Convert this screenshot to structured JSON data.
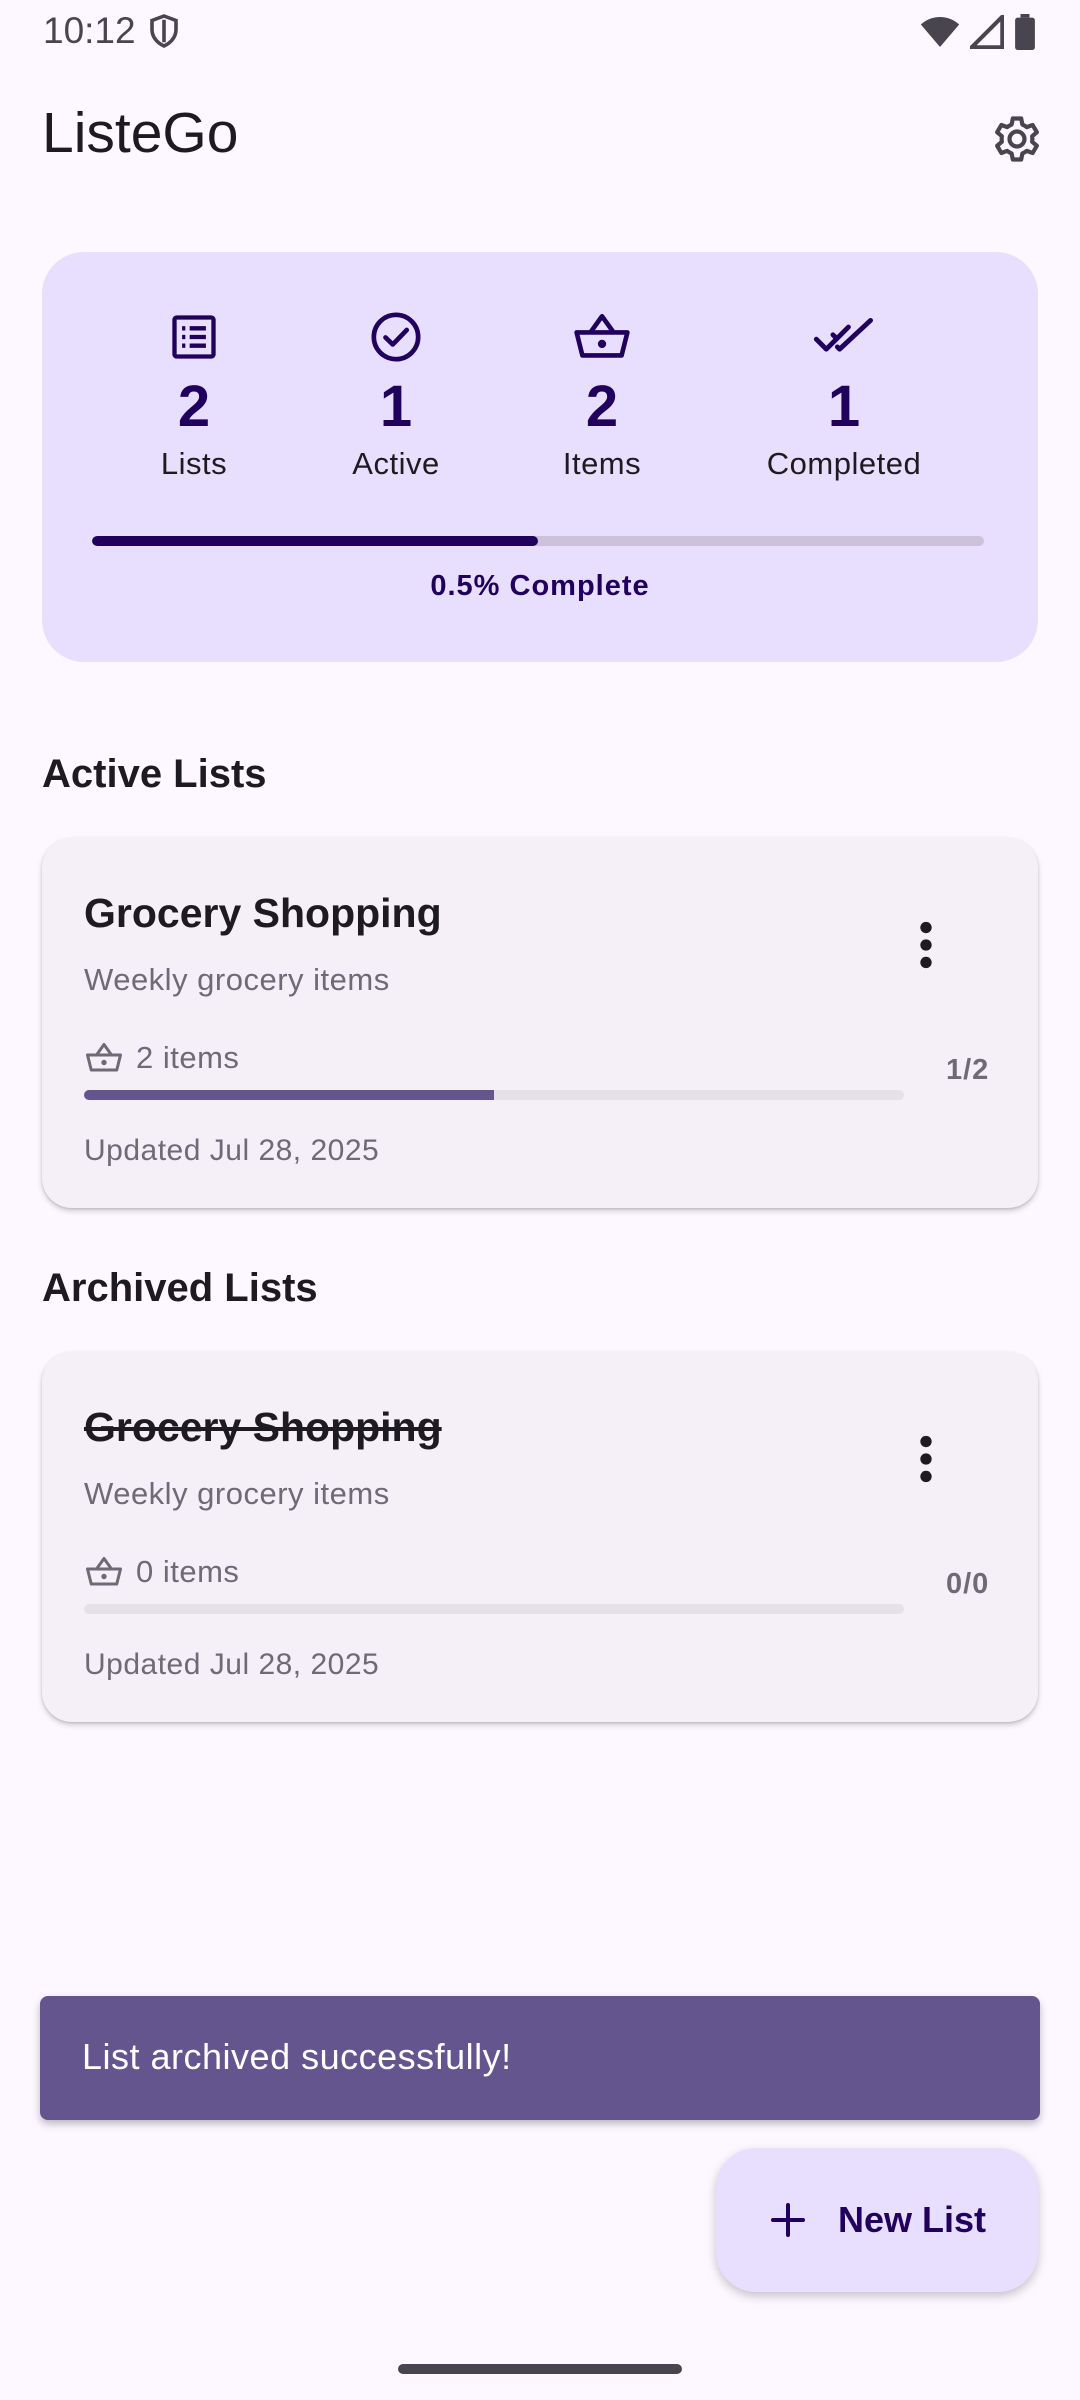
{
  "status_bar": {
    "time": "10:12"
  },
  "app_bar": {
    "title": "ListeGo"
  },
  "stats": {
    "lists": {
      "value": "2",
      "label": "Lists"
    },
    "active": {
      "value": "1",
      "label": "Active"
    },
    "items": {
      "value": "2",
      "label": "Items"
    },
    "completed": {
      "value": "1",
      "label": "Completed"
    },
    "progress_fraction": 0.5,
    "complete_text": "0.5% Complete"
  },
  "active_section": {
    "title": "Active Lists",
    "cards": [
      {
        "title": "Grocery Shopping",
        "description": "Weekly grocery items",
        "items_text": "2 items",
        "count": "1/2",
        "progress_fraction": 0.5,
        "updated": "Updated Jul 28, 2025"
      }
    ]
  },
  "archived_section": {
    "title": "Archived Lists",
    "cards": [
      {
        "title": "Grocery Shopping",
        "description": "Weekly grocery items",
        "items_text": "0 items",
        "count": "0/0",
        "progress_fraction": 0,
        "updated": "Updated Jul 28, 2025"
      }
    ]
  },
  "snackbar": {
    "message": "List archived successfully!"
  },
  "fab": {
    "label": "New List"
  },
  "colors": {
    "background": "#fdf7ff",
    "stats_card": "#e8defd",
    "primary_dark": "#21005d",
    "accent": "#65558f",
    "card_bg": "#f5eff7"
  }
}
